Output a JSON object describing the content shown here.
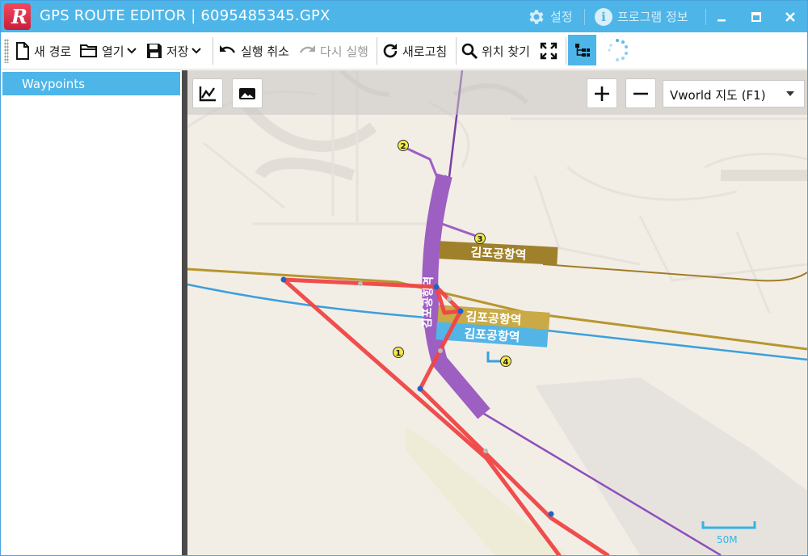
{
  "window": {
    "title": "GPS ROUTE EDITOR | 6095485345.GPX",
    "settings_label": "설정",
    "about_label": "프로그램 정보",
    "minimize_glyph": "▁",
    "maximize_glyph": "▢",
    "close_glyph": "✕"
  },
  "toolbar": {
    "new_route": "새 경로",
    "open": "열기",
    "save": "저장",
    "undo": "실행 취소",
    "redo": "다시 실행",
    "refresh": "새로고침",
    "find_location": "위치 찾기"
  },
  "sidebar": {
    "items": [
      {
        "label": "Waypoints"
      }
    ]
  },
  "map": {
    "layer_select": "Vworld 지도 (F1)",
    "scale_label": "50M",
    "station_labels": [
      "김포공항역",
      "김포공항역",
      "김포공항역"
    ],
    "vertical_station_label": "김포공항역",
    "waypoint_numbers": [
      "1",
      "2",
      "3",
      "4"
    ],
    "colors": {
      "accent": "#4db5e8",
      "route": "#f04545",
      "line_purple": "#9d5fc2",
      "line_gold": "#b8962e",
      "line_blue": "#3aa0dd"
    }
  }
}
